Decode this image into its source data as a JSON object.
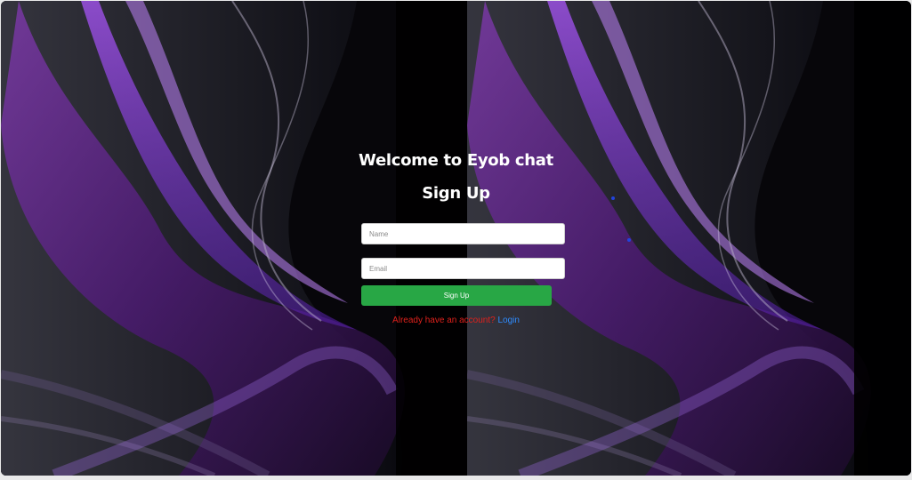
{
  "page": {
    "welcome": "Welcome to Eyob chat",
    "heading": "Sign Up"
  },
  "form": {
    "name_placeholder": "Name",
    "email_placeholder": "Email",
    "submit_label": "Sign Up"
  },
  "footer": {
    "prompt": "Already have an account?",
    "link_label": "Login"
  },
  "colors": {
    "button": "#28a745",
    "prompt_text": "#e0211c",
    "link": "#2f8cff",
    "background": "#000000",
    "accent_purple": "#8a2be2"
  }
}
